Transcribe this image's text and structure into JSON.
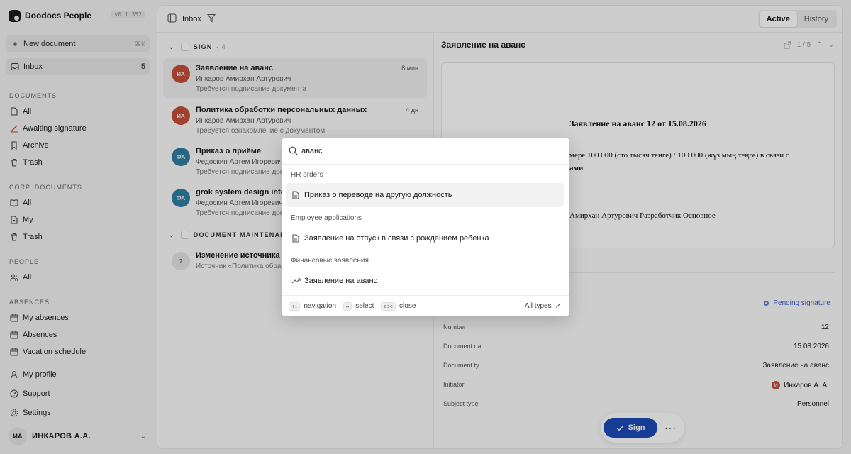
{
  "app": {
    "name": "Doodocs People",
    "version": "v0.1.352"
  },
  "sidebar": {
    "new_document": "New document",
    "new_kbd": "⌘K",
    "inbox": {
      "label": "Inbox",
      "count": "5"
    },
    "sections": [
      {
        "title": "DOCUMENTS",
        "items": [
          {
            "label": "All",
            "icon": "file-icon"
          },
          {
            "label": "Awaiting signature",
            "icon": "signature-icon"
          },
          {
            "label": "Archive",
            "icon": "bookmark-icon"
          },
          {
            "label": "Trash",
            "icon": "trash-icon"
          }
        ]
      },
      {
        "title": "CORP. DOCUMENTS",
        "items": [
          {
            "label": "All",
            "icon": "book-icon"
          },
          {
            "label": "My",
            "icon": "file-user-icon"
          },
          {
            "label": "Trash",
            "icon": "trash-icon"
          }
        ]
      },
      {
        "title": "PEOPLE",
        "items": [
          {
            "label": "All",
            "icon": "users-icon"
          }
        ]
      },
      {
        "title": "ABSENCES",
        "items": [
          {
            "label": "My absences",
            "icon": "calendar-icon"
          },
          {
            "label": "Absences",
            "icon": "calendar-icon"
          },
          {
            "label": "Vacation schedule",
            "icon": "calendar-icon"
          }
        ]
      }
    ],
    "bottom": [
      {
        "label": "My profile",
        "icon": "user-icon"
      },
      {
        "label": "Support",
        "icon": "help-icon"
      },
      {
        "label": "Settings",
        "icon": "gear-icon"
      }
    ],
    "user": {
      "initials": "ИА",
      "name": "ИНКАРОВ А.А."
    }
  },
  "header": {
    "title": "Inbox",
    "tabs": [
      "Active",
      "History"
    ]
  },
  "groups": [
    {
      "name": "SIGN",
      "count": "4"
    },
    {
      "name": "DOCUMENT MAINTENANCE",
      "count": ""
    }
  ],
  "rows": [
    {
      "initials": "ИА",
      "color": "#c4503a",
      "title": "Заявление на аванс",
      "person": "Инкаров Амирхан Артурович",
      "note": "Требуется подписание документа",
      "time": "8 мин"
    },
    {
      "initials": "ИА",
      "color": "#c4503a",
      "title": "Политика обработки персональных данных",
      "person": "Инкаров Амирхан Артурович",
      "note": "Требуется ознакомление с документом",
      "time": "4 дн"
    },
    {
      "initials": "ФА",
      "color": "#2f7ea0",
      "title": "Приказ о приёме",
      "person": "Федоскин Артем Игоревич",
      "note": "Требуется подписание документа",
      "time": ""
    },
    {
      "initials": "ФА",
      "color": "#2f7ea0",
      "title": "grok system design interview",
      "person": "Федоскин Артем Игоревич",
      "note": "Требуется подписание документа",
      "time": ""
    },
    {
      "initials": "?",
      "color": "#e4e4e4",
      "title": "Изменение источника к",
      "person": "",
      "note": "Источник «Политика обра",
      "time": ""
    }
  ],
  "detail": {
    "title": "Заявление на аванс",
    "pager": "1 / 5",
    "doc": {
      "heading": "Заявление на аванс 12 от 15.08.2026",
      "line1": "мере 100 000 (сто тысяч тенге) / 100 000 (жүз мың теңге) в связи с",
      "line2": "ами",
      "line3": "Амирхан Артурович Разработчик Основное"
    },
    "status": "Pending signature",
    "props": [
      {
        "label": "Number",
        "value": "12"
      },
      {
        "label": "Document da...",
        "value": "15.08.2026"
      },
      {
        "label": "Document ty...",
        "value": "Заявление на аванс"
      },
      {
        "label": "Initiator",
        "value": "Инкаров А. А.",
        "badge": "И"
      },
      {
        "label": "Subject type",
        "value": "Personnel"
      }
    ],
    "sign_label": "Sign"
  },
  "palette": {
    "query": "аванс",
    "sections": [
      {
        "title": "HR orders",
        "items": [
          {
            "label": "Приказ о переводе на другую должность",
            "icon": "document-icon"
          }
        ]
      },
      {
        "title": "Employee applications",
        "items": [
          {
            "label": "Заявление на отпуск в связи с рождением ребенка",
            "icon": "document-icon"
          }
        ]
      },
      {
        "title": "Финансовые заявления",
        "items": [
          {
            "label": "Заявление на аванс",
            "icon": "trend-icon"
          }
        ]
      }
    ],
    "footer": {
      "nav_key": "↑↓",
      "nav": "navigation",
      "select_key": "↵",
      "select": "select",
      "close_key": "esc",
      "close": "close",
      "types": "All types"
    }
  }
}
